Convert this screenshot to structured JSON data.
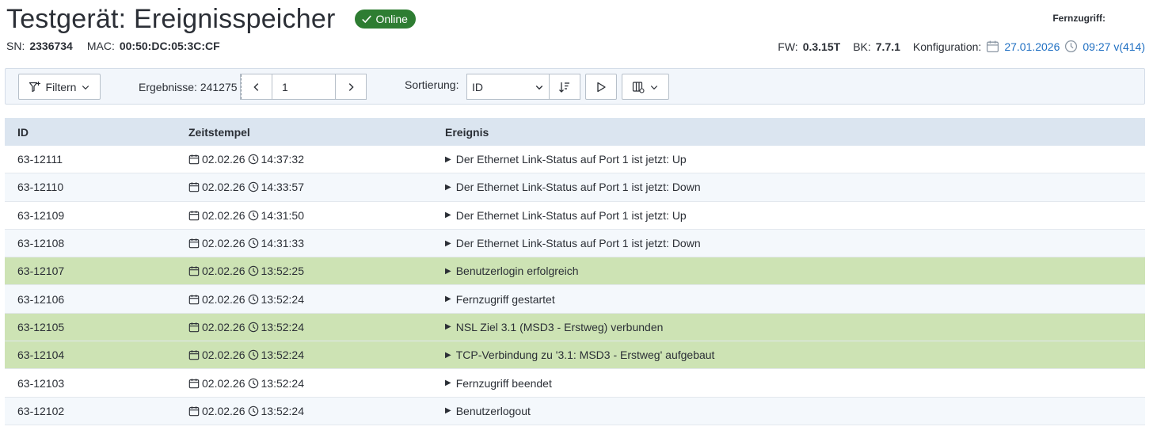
{
  "header": {
    "title": "Testgerät: Ereignisspeicher",
    "status": "Online",
    "remote_label": "Fernzugriff:",
    "sn_label": "SN:",
    "sn_value": "2336734",
    "mac_label": "MAC:",
    "mac_value": "00:50:DC:05:3C:CF",
    "fw_label": "FW:",
    "fw_value": "0.3.15T",
    "bk_label": "BK:",
    "bk_value": "7.7.1",
    "config_label": "Konfiguration:",
    "config_date": "27.01.2026",
    "config_time": "09:27 v(414)"
  },
  "toolbar": {
    "filter_label": "Filtern",
    "results_label": "Ergebnisse: 241275",
    "page_value": "1",
    "sort_label": "Sortierung:",
    "sort_value": "ID"
  },
  "table": {
    "headers": [
      "ID",
      "Zeitstempel",
      "Ereignis"
    ],
    "rows": [
      {
        "id": "63-12111",
        "date": "02.02.26",
        "time": "14:37:32",
        "event": "Der Ethernet Link-Status auf Port 1 ist jetzt: Up"
      },
      {
        "id": "63-12110",
        "date": "02.02.26",
        "time": "14:33:57",
        "event": "Der Ethernet Link-Status auf Port 1 ist jetzt: Down"
      },
      {
        "id": "63-12109",
        "date": "02.02.26",
        "time": "14:31:50",
        "event": "Der Ethernet Link-Status auf Port 1 ist jetzt: Up"
      },
      {
        "id": "63-12108",
        "date": "02.02.26",
        "time": "14:31:33",
        "event": "Der Ethernet Link-Status auf Port 1 ist jetzt: Down"
      },
      {
        "id": "63-12107",
        "date": "02.02.26",
        "time": "13:52:25",
        "event": "Benutzerlogin erfolgreich"
      },
      {
        "id": "63-12106",
        "date": "02.02.26",
        "time": "13:52:24",
        "event": "Fernzugriff gestartet"
      },
      {
        "id": "63-12105",
        "date": "02.02.26",
        "time": "13:52:24",
        "event": "NSL Ziel 3.1 (MSD3 - Erstweg) verbunden"
      },
      {
        "id": "63-12104",
        "date": "02.02.26",
        "time": "13:52:24",
        "event": "TCP-Verbindung zu '3.1: MSD3 - Erstweg' aufgebaut"
      },
      {
        "id": "63-12103",
        "date": "02.02.26",
        "time": "13:52:24",
        "event": "Fernzugriff beendet"
      },
      {
        "id": "63-12102",
        "date": "02.02.26",
        "time": "13:52:24",
        "event": "Benutzerlogout"
      }
    ]
  },
  "colors": {
    "success_row": "#cde3b4",
    "alt_row": "#f4f8fc",
    "header_row": "#dbe5f0",
    "badge": "#2e7d32",
    "link": "#1f6fc2"
  }
}
